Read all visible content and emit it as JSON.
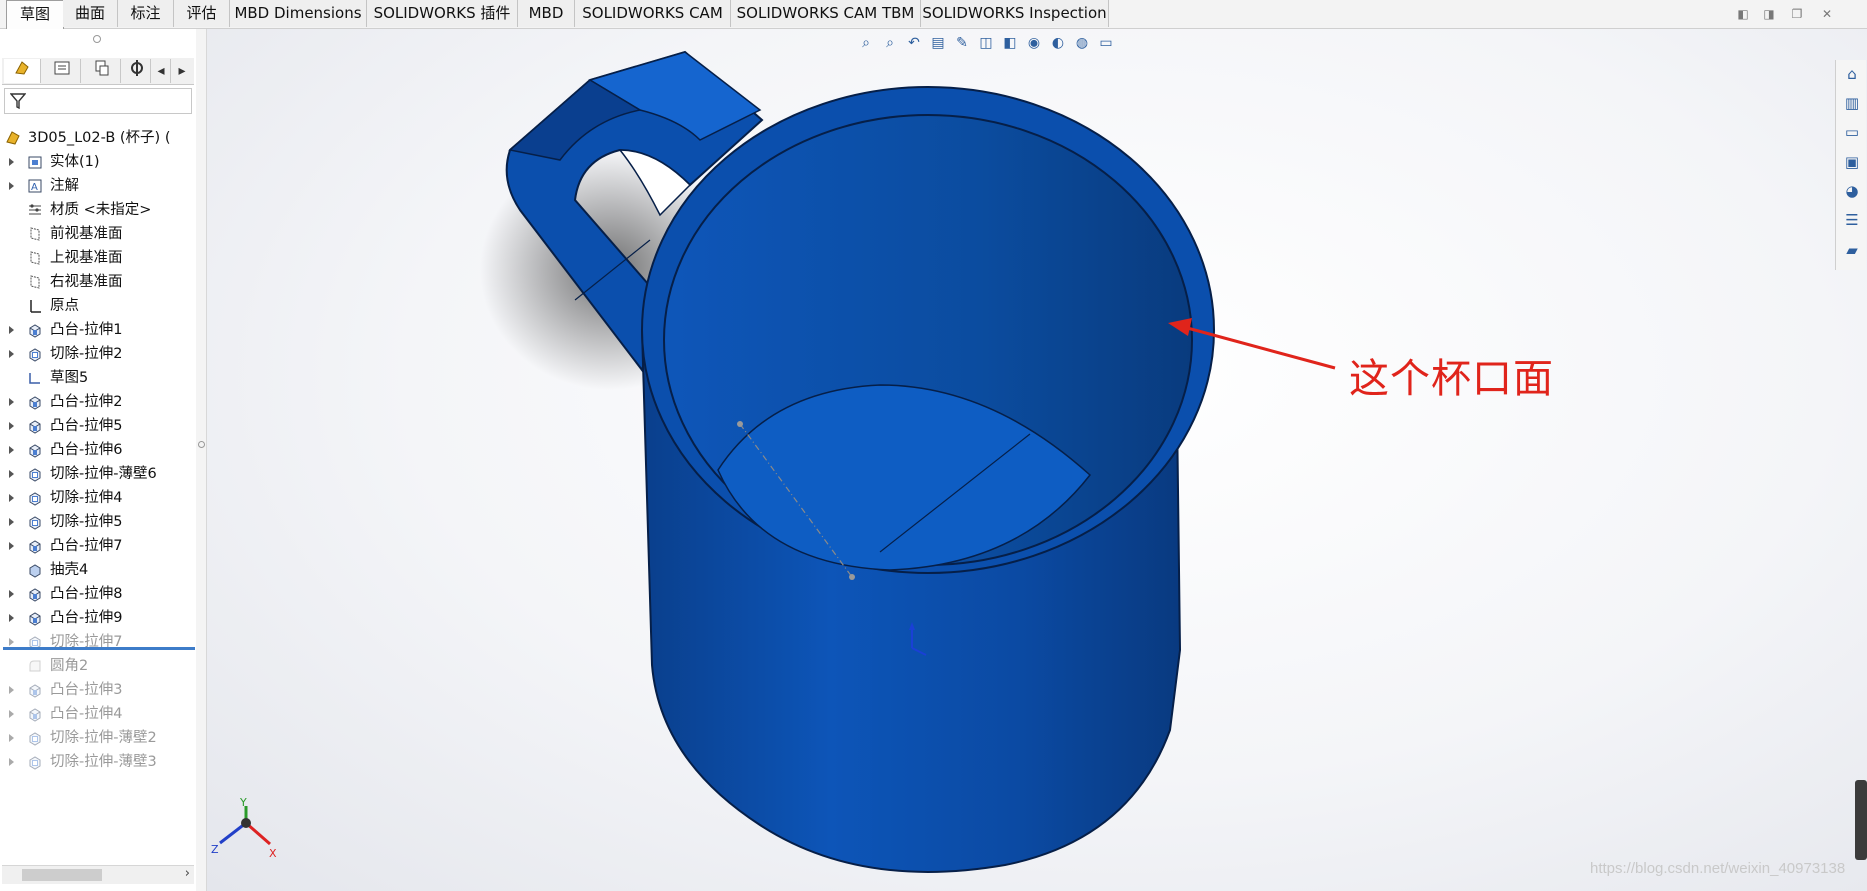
{
  "tabs": [
    {
      "label": "草图"
    },
    {
      "label": "曲面"
    },
    {
      "label": "标注"
    },
    {
      "label": "评估"
    },
    {
      "label": "MBD Dimensions"
    },
    {
      "label": "SOLIDWORKS 插件"
    },
    {
      "label": "MBD"
    },
    {
      "label": "SOLIDWORKS CAM"
    },
    {
      "label": "SOLIDWORKS CAM TBM"
    },
    {
      "label": "SOLIDWORKS Inspection"
    }
  ],
  "feature_tree": {
    "root": "3D05_L02-B  (杯子)   (",
    "items": [
      {
        "label": "实体(1)",
        "icon": "solid-bodies-icon",
        "expandable": true,
        "dim": false
      },
      {
        "label": "注解",
        "icon": "annotations-icon",
        "expandable": true,
        "dim": false
      },
      {
        "label": "材质 <未指定>",
        "icon": "material-icon",
        "expandable": false,
        "dim": false
      },
      {
        "label": "前视基准面",
        "icon": "plane-icon",
        "expandable": false,
        "dim": false
      },
      {
        "label": "上视基准面",
        "icon": "plane-icon",
        "expandable": false,
        "dim": false
      },
      {
        "label": "右视基准面",
        "icon": "plane-icon",
        "expandable": false,
        "dim": false
      },
      {
        "label": "原点",
        "icon": "origin-icon",
        "expandable": false,
        "dim": false
      },
      {
        "label": "凸台-拉伸1",
        "icon": "boss-extrude-icon",
        "expandable": true,
        "dim": false
      },
      {
        "label": "切除-拉伸2",
        "icon": "cut-extrude-icon",
        "expandable": true,
        "dim": false
      },
      {
        "label": "草图5",
        "icon": "sketch-icon",
        "expandable": false,
        "dim": false
      },
      {
        "label": "凸台-拉伸2",
        "icon": "boss-extrude-icon",
        "expandable": true,
        "dim": false
      },
      {
        "label": "凸台-拉伸5",
        "icon": "boss-extrude-icon",
        "expandable": true,
        "dim": false
      },
      {
        "label": "凸台-拉伸6",
        "icon": "boss-extrude-icon",
        "expandable": true,
        "dim": false
      },
      {
        "label": "切除-拉伸-薄壁6",
        "icon": "cut-extrude-icon",
        "expandable": true,
        "dim": false
      },
      {
        "label": "切除-拉伸4",
        "icon": "cut-extrude-icon",
        "expandable": true,
        "dim": false
      },
      {
        "label": "切除-拉伸5",
        "icon": "cut-extrude-icon",
        "expandable": true,
        "dim": false
      },
      {
        "label": "凸台-拉伸7",
        "icon": "boss-extrude-icon",
        "expandable": true,
        "dim": false
      },
      {
        "label": "抽壳4",
        "icon": "shell-icon",
        "expandable": false,
        "dim": false
      },
      {
        "label": "凸台-拉伸8",
        "icon": "boss-extrude-icon",
        "expandable": true,
        "dim": false
      },
      {
        "label": "凸台-拉伸9",
        "icon": "boss-extrude-icon",
        "expandable": true,
        "dim": false
      },
      {
        "label": "切除-拉伸7",
        "icon": "cut-extrude-icon",
        "expandable": true,
        "dim": true
      },
      {
        "label": "圆角2",
        "icon": "fillet-icon",
        "expandable": false,
        "dim": true
      },
      {
        "label": "凸台-拉伸3",
        "icon": "boss-extrude-icon",
        "expandable": true,
        "dim": true
      },
      {
        "label": "凸台-拉伸4",
        "icon": "boss-extrude-icon",
        "expandable": true,
        "dim": true
      },
      {
        "label": "切除-拉伸-薄壁2",
        "icon": "cut-extrude-icon",
        "expandable": true,
        "dim": true
      },
      {
        "label": "切除-拉伸-薄壁3",
        "icon": "cut-extrude-icon",
        "expandable": true,
        "dim": true
      }
    ]
  },
  "triad": {
    "x": "X",
    "y": "Y",
    "z": "Z"
  },
  "annotation": {
    "text": "这个杯口面",
    "color": "#e0241b"
  },
  "watermark": "https://blog.csdn.net/weixin_40973138",
  "colors": {
    "part_blue": "#0a4fb0",
    "rollback_bar": "#3d7cc9"
  }
}
